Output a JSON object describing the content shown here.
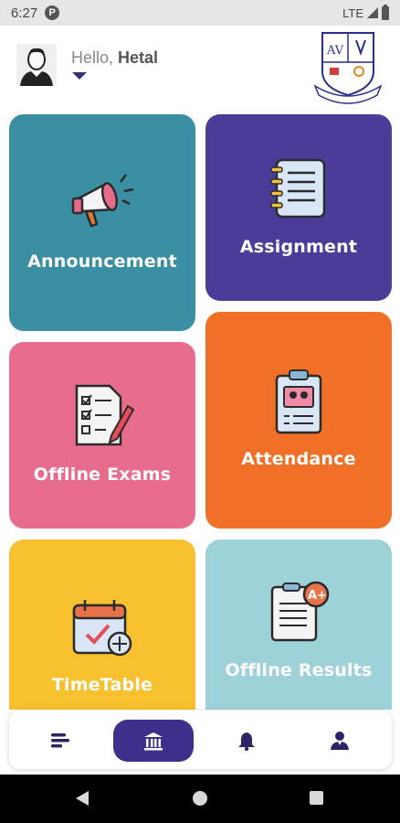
{
  "status_bar": {
    "time": "6:27",
    "network": "LTE"
  },
  "header": {
    "greeting": "Hello,",
    "user_name": "Hetal"
  },
  "tiles": {
    "announcement": "Announcement",
    "assignment": "Assignment",
    "offline_exams": "Offline Exams",
    "attendance": "Attendance",
    "timetable": "TimeTable",
    "offline_results": "Offline Results"
  },
  "bottom_nav": {
    "items": [
      "menu-icon",
      "school-icon",
      "bell-icon",
      "profile-icon"
    ],
    "active": "school-icon",
    "active_color": "#3d2f8a"
  },
  "colors": {
    "announcement": "#3b8fa2",
    "assignment": "#4c3c9a",
    "offline_exams": "#e86c8e",
    "attendance": "#f07028",
    "timetable": "#f6c02e",
    "offline_results": "#9dd2d8"
  }
}
